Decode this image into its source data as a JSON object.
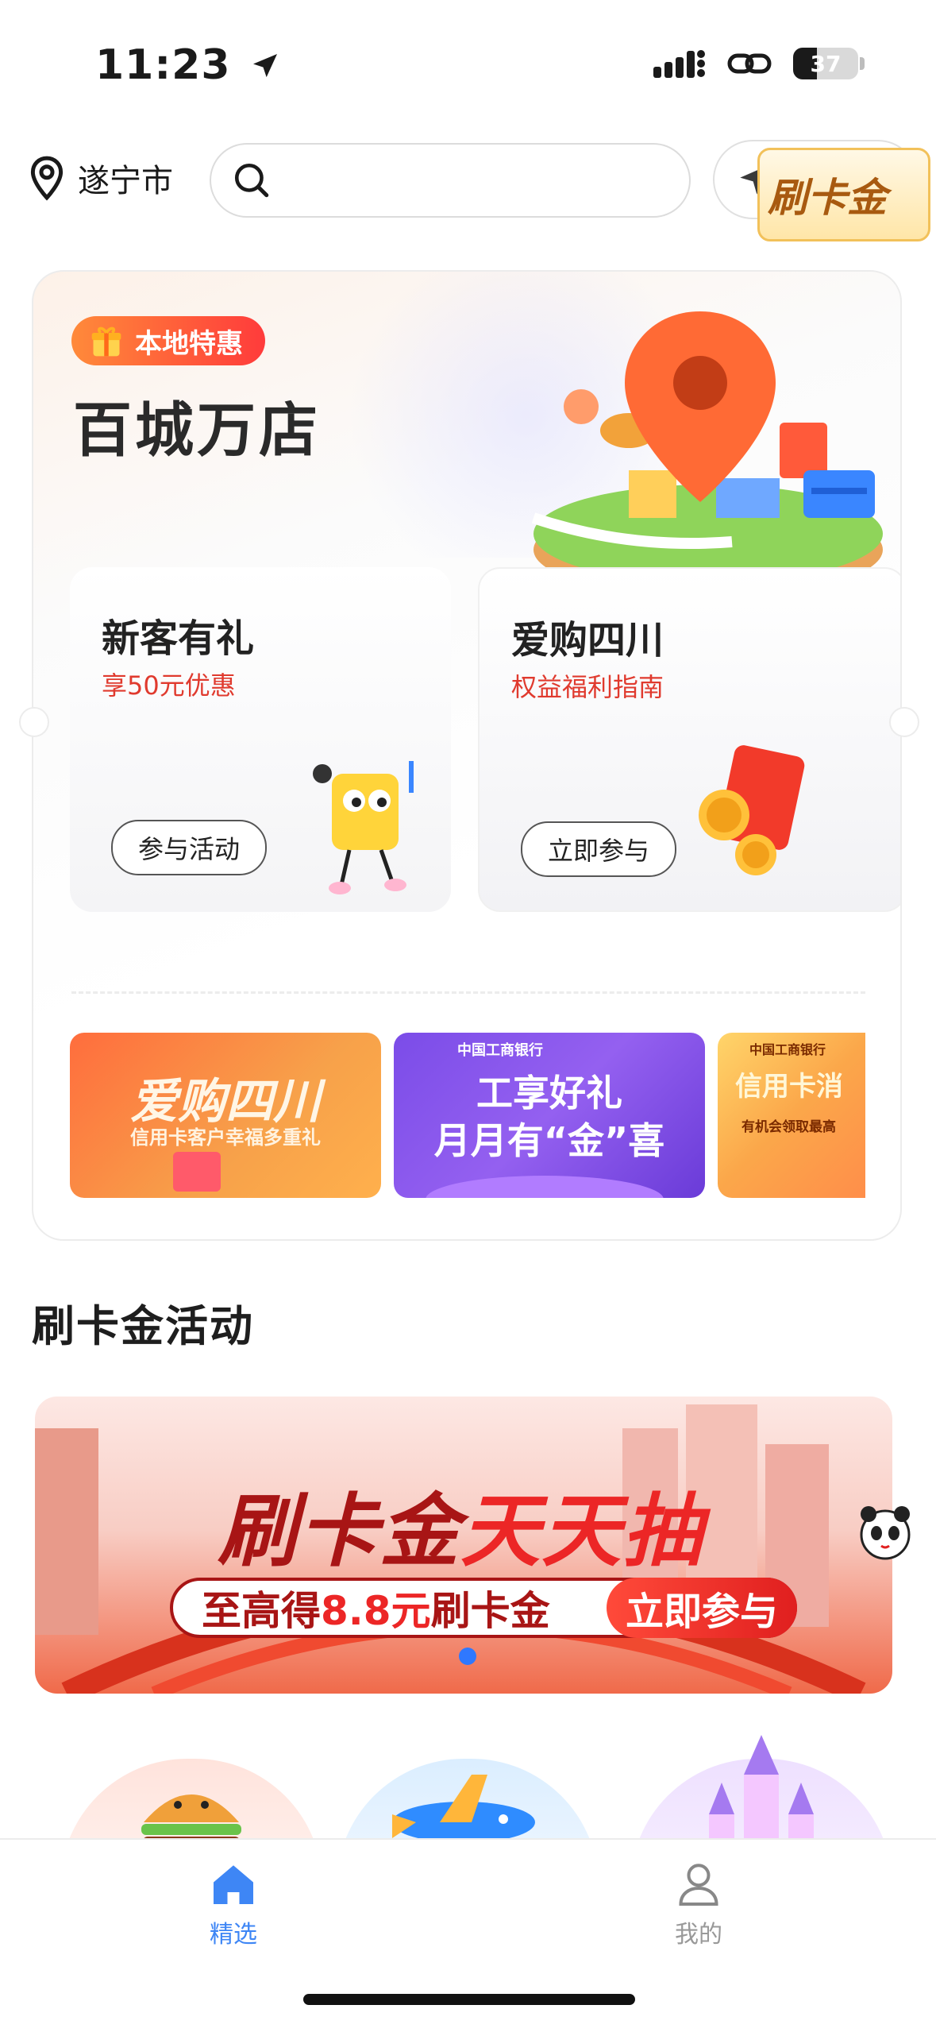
{
  "status_bar": {
    "time": "11:23",
    "battery": "37",
    "battery_level": 0.37
  },
  "header": {
    "city": "遂宁市",
    "search_placeholder": ""
  },
  "hero": {
    "badge": "本地特惠",
    "title": "百城万店",
    "cards": [
      {
        "title": "新客有礼",
        "desc": "享50元优惠",
        "button": "参与活动"
      },
      {
        "title": "爱购四川",
        "desc": "权益福利指南",
        "button": "立即参与"
      }
    ],
    "banners": [
      {
        "title": "爱购四川",
        "subtitle": "信用卡客户幸福多重礼"
      },
      {
        "bank": "中国工商银行",
        "line1": "工享好礼",
        "line2": "月月有“金”喜"
      },
      {
        "bank": "中国工商银行",
        "title": "信用卡消",
        "sub": "有机会领取最高"
      }
    ]
  },
  "section": {
    "title": "刷卡金活动"
  },
  "promo": {
    "title_dark": "刷卡金",
    "title_bright": "天天抽",
    "strip_prefix": "至高得",
    "strip_amount": "8.8元",
    "strip_suffix": "刷卡金",
    "cta": "立即参与",
    "logo_text": "刷卡金"
  },
  "tabbar": {
    "tabs": [
      {
        "label": "精选",
        "active": true
      },
      {
        "label": "我的",
        "active": false
      }
    ]
  },
  "colors": {
    "accent": "#3e86f5",
    "red": "#e03a2e",
    "badge_start": "#ff8a3a",
    "badge_end": "#ff3b3b"
  },
  "icons": [
    "location-pin-icon",
    "search-icon",
    "navigation-arrow-icon",
    "target-icon",
    "gift-icon",
    "home-icon",
    "user-icon",
    "cellular-signal-icon",
    "link-icon",
    "location-arrow-icon"
  ]
}
